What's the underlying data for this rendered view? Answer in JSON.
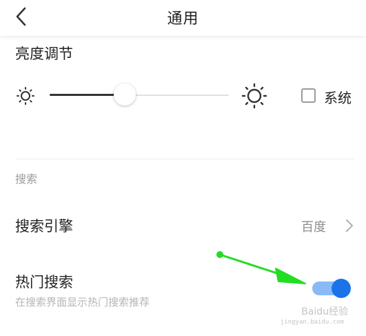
{
  "header": {
    "title": "通用",
    "back_icon": "chevron-left-icon"
  },
  "brightness": {
    "section_title": "亮度调节",
    "level": 0.42,
    "system_checkbox_label": "系统",
    "system_checked": false,
    "low_icon": "sun-small-icon",
    "high_icon": "sun-large-icon"
  },
  "search": {
    "group_label": "搜索",
    "engine_label": "搜索引擎",
    "engine_value": "百度",
    "hot_label": "热门搜索",
    "hot_subtitle": "在搜索界面显示热门搜索推荐",
    "hot_enabled": true
  },
  "colors": {
    "accent": "#1a73e8",
    "accent_light": "#8ab9f6",
    "arrow": "#22dd22"
  },
  "watermark": {
    "text": "Baidu经验",
    "sub": "jingyan.baidu.com"
  }
}
